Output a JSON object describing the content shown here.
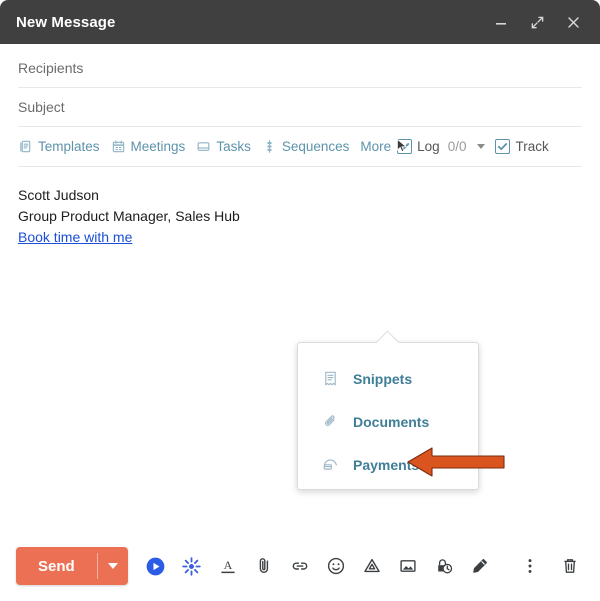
{
  "window": {
    "title": "New Message",
    "controls": [
      {
        "name": "minimize-button",
        "icon": "minimize-icon"
      },
      {
        "name": "expand-button",
        "icon": "expand-icon"
      },
      {
        "name": "close-button",
        "icon": "close-icon"
      }
    ]
  },
  "fields": {
    "recipients_placeholder": "Recipients",
    "subject_placeholder": "Subject"
  },
  "hubspot_toolbar": {
    "items": [
      {
        "label": "Templates",
        "icon": "templates-icon"
      },
      {
        "label": "Meetings",
        "icon": "calendar-icon"
      },
      {
        "label": "Tasks",
        "icon": "tasks-icon"
      },
      {
        "label": "Sequences",
        "icon": "sequences-icon"
      },
      {
        "label": "More",
        "icon": "none"
      }
    ],
    "log": {
      "label": "Log",
      "count": "0/0",
      "checked": true
    },
    "track": {
      "label": "Track",
      "checked": true
    },
    "accent_color": "#5d93ab"
  },
  "more_menu": {
    "items": [
      {
        "label": "Snippets",
        "icon": "snippet-document-icon"
      },
      {
        "label": "Documents",
        "icon": "paperclip-icon"
      },
      {
        "label": "Payments",
        "icon": "payment-card-icon"
      }
    ],
    "highlighted_item": "Payments",
    "annotation_arrow_color": "#d9541f"
  },
  "body": {
    "signature_name": "Scott Judson",
    "signature_title": "Group Product Manager, Sales Hub",
    "signature_link": "Book time with me",
    "link_color": "#1a4fd6"
  },
  "bottom_toolbar": {
    "send_label": "Send",
    "send_color": "#ec7154",
    "send_caret": "caret-down-icon",
    "left_tools": [
      {
        "name": "video-play-icon",
        "color": "#2b5ce6"
      },
      {
        "name": "sprocket-icon",
        "color": "#2b5ce6"
      },
      {
        "name": "format-text-icon",
        "color": "#3c4043"
      },
      {
        "name": "attach-paperclip-icon",
        "color": "#3c4043"
      },
      {
        "name": "insert-link-icon",
        "color": "#3c4043"
      },
      {
        "name": "emoji-icon",
        "color": "#3c4043"
      },
      {
        "name": "drive-icon",
        "color": "#3c4043"
      },
      {
        "name": "insert-photo-icon",
        "color": "#3c4043"
      },
      {
        "name": "confidential-mode-icon",
        "color": "#3c4043"
      },
      {
        "name": "signature-pen-icon",
        "color": "#3c4043"
      }
    ],
    "right_tools": [
      {
        "name": "more-options-icon"
      },
      {
        "name": "discard-trash-icon"
      }
    ]
  }
}
